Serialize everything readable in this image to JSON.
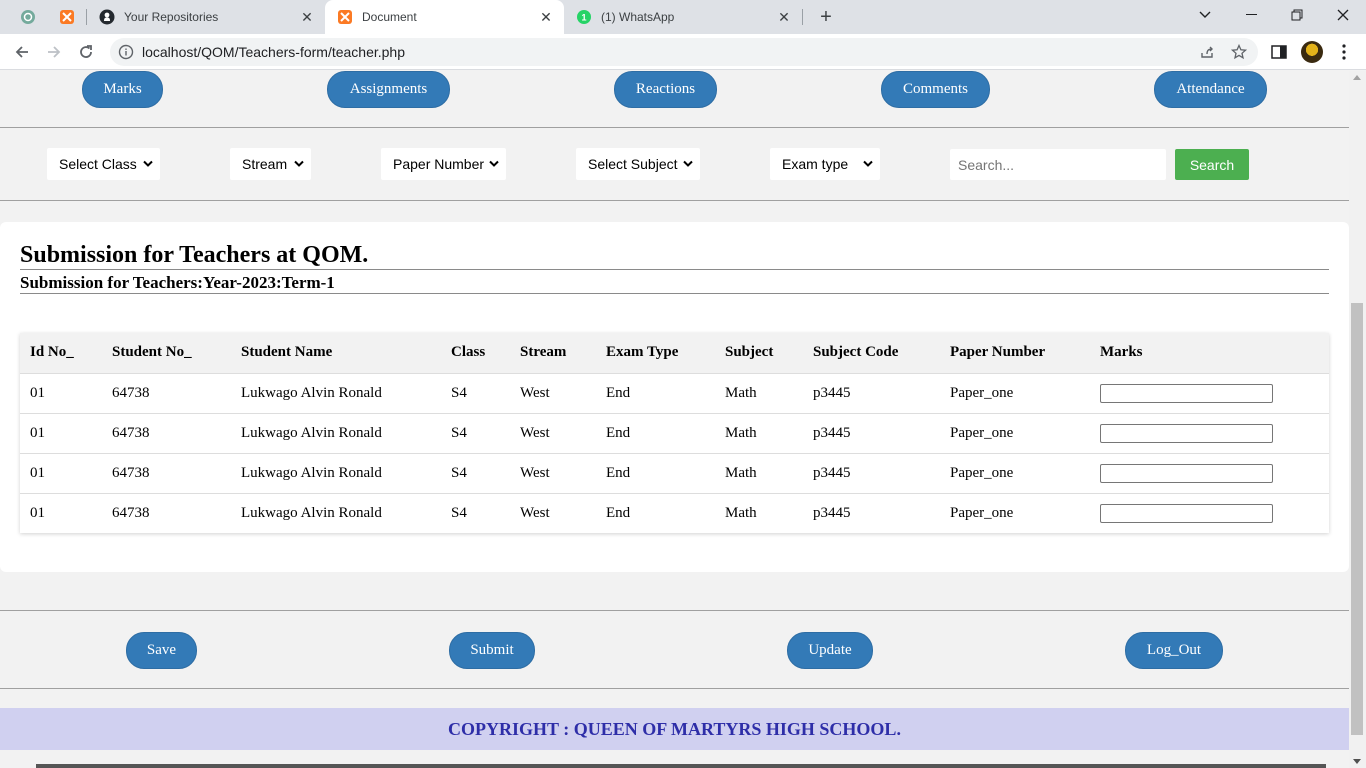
{
  "browser": {
    "tabs": [
      {
        "title": "Your Repositories",
        "icon": "github-icon"
      },
      {
        "title": "Document",
        "icon": "xampp-icon",
        "active": true
      },
      {
        "title": "(1) WhatsApp",
        "icon": "whatsapp-icon"
      }
    ],
    "url": "localhost/QOM/Teachers-form/teacher.php"
  },
  "nav": {
    "marks": "Marks",
    "assignments": "Assignments",
    "reactions": "Reactions",
    "comments": "Comments",
    "attendance": "Attendance"
  },
  "filters": {
    "select_class": "Select Class",
    "stream": "Stream",
    "paper_number": "Paper Number",
    "select_subject": "Select Subject",
    "exam_type": "Exam type",
    "search_placeholder": "Search...",
    "search_button": "Search"
  },
  "main": {
    "title": "Submission for Teachers at QOM.",
    "subtitle": "Submission for Teachers:Year-2023:Term-1"
  },
  "table": {
    "headers": [
      "Id No_",
      "Student No_",
      "Student Name",
      "Class",
      "Stream",
      "Exam Type",
      "Subject",
      "Subject Code",
      "Paper Number",
      "Marks"
    ],
    "rows": [
      [
        "01",
        "64738",
        "Lukwago Alvin Ronald",
        "S4",
        "West",
        "End",
        "Math",
        "p3445",
        "Paper_one"
      ],
      [
        "01",
        "64738",
        "Lukwago Alvin Ronald",
        "S4",
        "West",
        "End",
        "Math",
        "p3445",
        "Paper_one"
      ],
      [
        "01",
        "64738",
        "Lukwago Alvin Ronald",
        "S4",
        "West",
        "End",
        "Math",
        "p3445",
        "Paper_one"
      ],
      [
        "01",
        "64738",
        "Lukwago Alvin Ronald",
        "S4",
        "West",
        "End",
        "Math",
        "p3445",
        "Paper_one"
      ]
    ]
  },
  "actions": {
    "save": "Save",
    "submit": "Submit",
    "update": "Update",
    "logout": "Log_Out"
  },
  "footer": {
    "copyright": "COPYRIGHT : QUEEN OF MARTYRS HIGH SCHOOL."
  },
  "colors": {
    "primary_button": "#337ab7",
    "search_button": "#4caf50",
    "footer_bg": "#d0d0f0",
    "footer_text": "#2e2ea8"
  }
}
